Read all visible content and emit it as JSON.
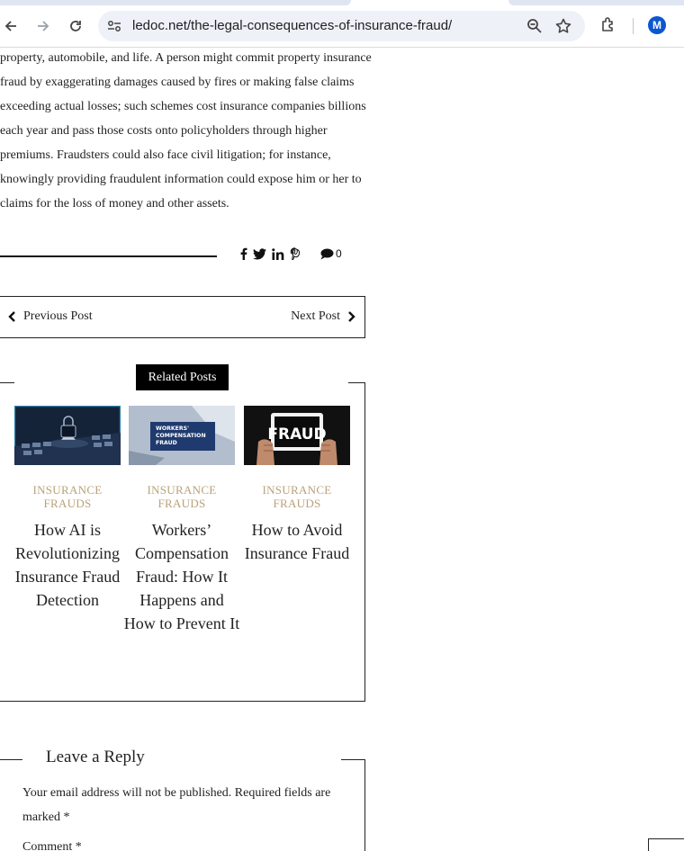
{
  "browser": {
    "url": "ledoc.net/the-legal-consequences-of-insurance-fraud/",
    "profile_initial": "M",
    "icons": [
      "back-arrow-icon",
      "forward-arrow-icon",
      "reload-icon",
      "site-info-icon",
      "zoom-icon",
      "bookmark-star-icon",
      "extensions-icon"
    ]
  },
  "article": {
    "lines": [
      "property, automobile, and life. A person might commit property insurance",
      "fraud by exaggerating damages caused by fires or making false claims",
      "exceeding actual losses; such schemes cost insurance companies billions",
      "each year and pass those costs onto policyholders through higher",
      "premiums. Fraudsters could also face civil litigation; for instance,",
      "knowingly providing fraudulent information could expose him or her to",
      "claims for the loss of money and other assets."
    ]
  },
  "share": {
    "icons": [
      "facebook-icon",
      "twitter-icon",
      "linkedin-icon",
      "pinterest-icon"
    ],
    "comment_count": "0"
  },
  "post_nav": {
    "previous_label": "Previous Post",
    "next_label": "Next Post"
  },
  "related": {
    "heading": "Related Posts",
    "posts": [
      {
        "category_line1": "INSURANCE",
        "category_line2": "FRAUDS",
        "title": "How AI is Revolutionizing Insurance Fraud Detection"
      },
      {
        "category_line1": "INSURANCE",
        "category_line2": "FRAUDS",
        "title": "Workers’ Compensation Fraud: How It Happens and How to Prevent It",
        "thumb_text_line1": "WORKERS'",
        "thumb_text_line2": "COMPENSATION",
        "thumb_text_line3": "FRAUD"
      },
      {
        "category_line1": "INSURANCE",
        "category_line2": "FRAUDS",
        "title": "How to Avoid Insurance Fraud",
        "thumb_text": "FRAUD"
      }
    ]
  },
  "reply": {
    "heading": "Leave a Reply",
    "note": "Your email address will not be published. Required fields are marked *",
    "comment_label": "Comment *"
  },
  "colors": {
    "category": "#b9a27a",
    "omnibox": "#eef1f7",
    "avatar": "#0b57d0"
  }
}
